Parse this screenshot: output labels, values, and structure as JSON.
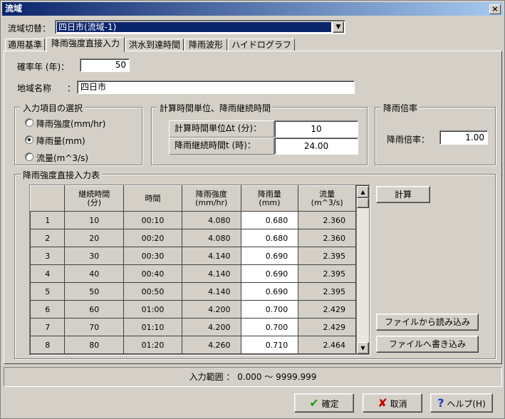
{
  "window": {
    "title": "流域",
    "close_glyph": "×"
  },
  "basin_switch": {
    "label": "流域切替：",
    "selected": "四日市(流域-1)"
  },
  "tabs": [
    {
      "label": "適用基準",
      "active": false
    },
    {
      "label": "降雨強度直接入力",
      "active": true
    },
    {
      "label": "洪水到達時間",
      "active": false
    },
    {
      "label": "降雨波形",
      "active": false
    },
    {
      "label": "ハイドログラフ",
      "active": false
    }
  ],
  "probability_year": {
    "label": "確率年 (年)：",
    "value": "50"
  },
  "region_name": {
    "label": "地域名称",
    "colon": "：",
    "value": "四日市"
  },
  "input_selection": {
    "title": "入力項目の選択",
    "options": [
      {
        "label": "降雨強度(mm/hr)",
        "selected": false
      },
      {
        "label": "降雨量(mm)",
        "selected": true
      },
      {
        "label": "流量(m^3/s)",
        "selected": false
      }
    ]
  },
  "calc_time": {
    "title": "計算時間単位、降雨継続時間",
    "rows": [
      {
        "label": "計算時間単位Δt (分)：",
        "value": "10"
      },
      {
        "label": "降雨継続時間t (時)：",
        "value": "24.00"
      }
    ]
  },
  "rain_factor": {
    "title": "降雨倍率",
    "label": "降雨倍率：",
    "value": "1.00"
  },
  "table": {
    "title": "降雨強度直接入力表",
    "headers": [
      "継続時間\n(分)",
      "時間",
      "降雨強度\n(mm/hr)",
      "降雨量\n(mm)",
      "流量\n(m^3/s)"
    ],
    "rows": [
      {
        "no": "1",
        "duration": "10",
        "time": "00:10",
        "intensity": "4.080",
        "rainfall": "0.680",
        "flow": "2.360"
      },
      {
        "no": "2",
        "duration": "20",
        "time": "00:20",
        "intensity": "4.080",
        "rainfall": "0.680",
        "flow": "2.360"
      },
      {
        "no": "3",
        "duration": "30",
        "time": "00:30",
        "intensity": "4.140",
        "rainfall": "0.690",
        "flow": "2.395"
      },
      {
        "no": "4",
        "duration": "40",
        "time": "00:40",
        "intensity": "4.140",
        "rainfall": "0.690",
        "flow": "2.395"
      },
      {
        "no": "5",
        "duration": "50",
        "time": "00:50",
        "intensity": "4.140",
        "rainfall": "0.690",
        "flow": "2.395"
      },
      {
        "no": "6",
        "duration": "60",
        "time": "01:00",
        "intensity": "4.200",
        "rainfall": "0.700",
        "flow": "2.429"
      },
      {
        "no": "7",
        "duration": "70",
        "time": "01:10",
        "intensity": "4.200",
        "rainfall": "0.700",
        "flow": "2.429"
      },
      {
        "no": "8",
        "duration": "80",
        "time": "01:20",
        "intensity": "4.260",
        "rainfall": "0.710",
        "flow": "2.464"
      }
    ]
  },
  "buttons": {
    "calc": "計算",
    "load_file": "ファイルから読み込み",
    "save_file": "ファイルへ書き込み",
    "ok": "確定",
    "cancel": "取消",
    "help": "ヘルプ(H)"
  },
  "status": {
    "input_range": "入力範囲 ： 0.000 ～ 9999.999"
  }
}
